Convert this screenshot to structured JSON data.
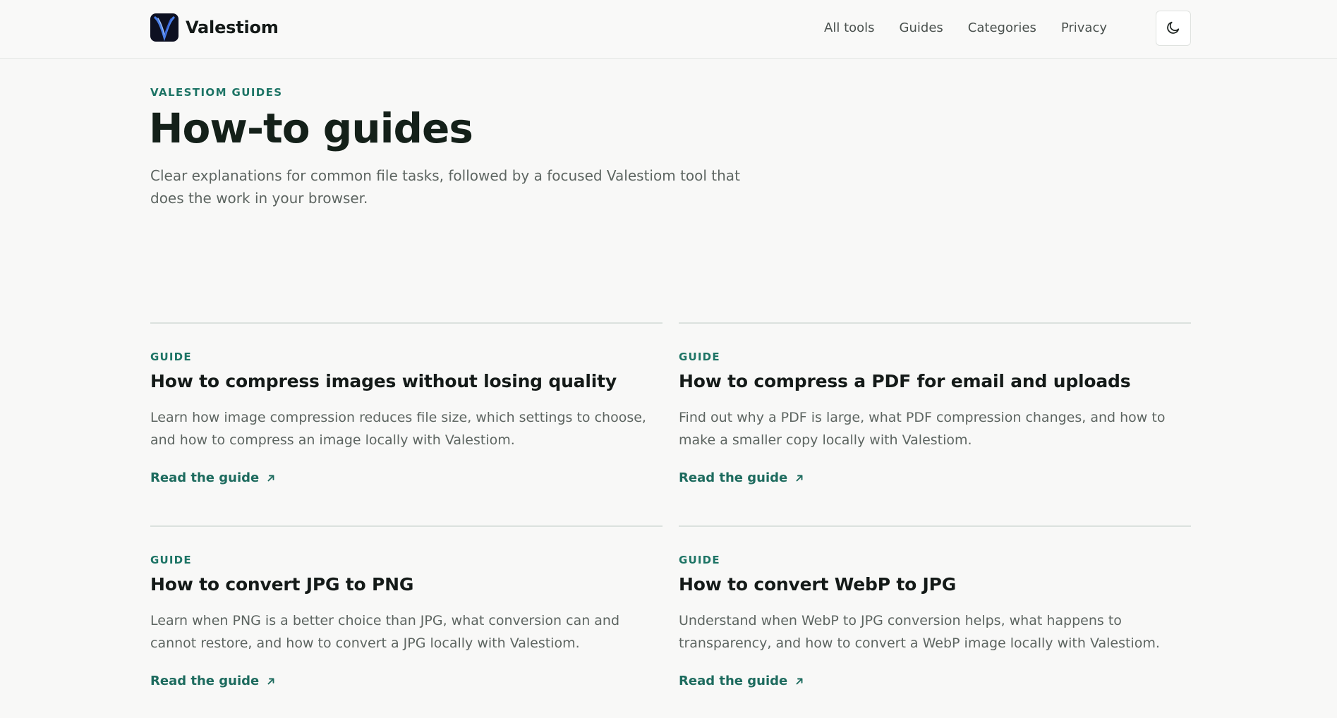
{
  "header": {
    "brand_name": "Valestiom",
    "logo_icon": "valestiom-v-logo",
    "nav": [
      {
        "label": "All tools"
      },
      {
        "label": "Guides"
      },
      {
        "label": "Categories"
      },
      {
        "label": "Privacy"
      }
    ],
    "theme_toggle_icon": "moon-icon"
  },
  "hero": {
    "eyebrow": "VALESTIOM GUIDES",
    "title": "How-to guides",
    "lede": "Clear explanations for common file tasks, followed by a focused Valestiom tool that does the work in your browser."
  },
  "guides": [
    {
      "label": "GUIDE",
      "title": "How to compress images without losing quality",
      "description": "Learn how image compression reduces file size, which settings to choose, and how to compress an image locally with Valestiom.",
      "link": "Read the guide"
    },
    {
      "label": "GUIDE",
      "title": "How to compress a PDF for email and uploads",
      "description": "Find out why a PDF is large, what PDF compression changes, and how to make a smaller copy locally with Valestiom.",
      "link": "Read the guide"
    },
    {
      "label": "GUIDE",
      "title": "How to convert JPG to PNG",
      "description": "Learn when PNG is a better choice than JPG, what conversion can and cannot restore, and how to convert a JPG locally with Valestiom.",
      "link": "Read the guide"
    },
    {
      "label": "GUIDE",
      "title": "How to convert WebP to JPG",
      "description": "Understand when WebP to JPG conversion helps, what happens to transparency, and how to convert a WebP image locally with Valestiom.",
      "link": "Read the guide"
    }
  ],
  "colors": {
    "accent": "#1d7465",
    "background": "#f8f8f7",
    "text": "#141a18",
    "muted_text": "#5d6561"
  }
}
